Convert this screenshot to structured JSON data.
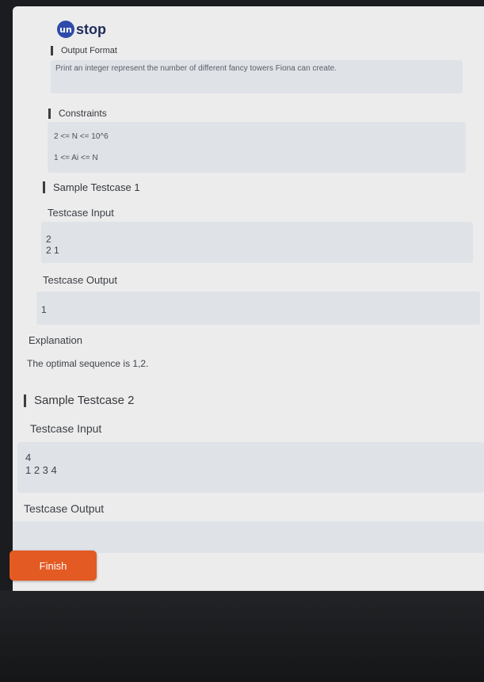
{
  "brand": {
    "logo_mark": "un",
    "logo_text": "stop"
  },
  "output_format": {
    "heading": "Output Format",
    "text": "Print an integer represent the number of different fancy towers Fiona can create."
  },
  "constraints": {
    "heading": "Constraints",
    "line1": "2 <= N <= 10^6",
    "line2": "1 <= Ai <= N"
  },
  "sample1": {
    "heading": "Sample Testcase 1",
    "input_label": "Testcase Input",
    "input_value": "2\n2 1",
    "output_label": "Testcase Output",
    "output_value": "1",
    "explanation_label": "Explanation",
    "explanation_text": "The optimal sequence is 1,2."
  },
  "sample2": {
    "heading": "Sample Testcase 2",
    "input_label": "Testcase Input",
    "input_value": "4\n1 2 3 4",
    "output_label": "Testcase Output"
  },
  "actions": {
    "finish_label": "Finish"
  },
  "colors": {
    "accent": "#e35a23",
    "brand": "#2f4aa8"
  }
}
